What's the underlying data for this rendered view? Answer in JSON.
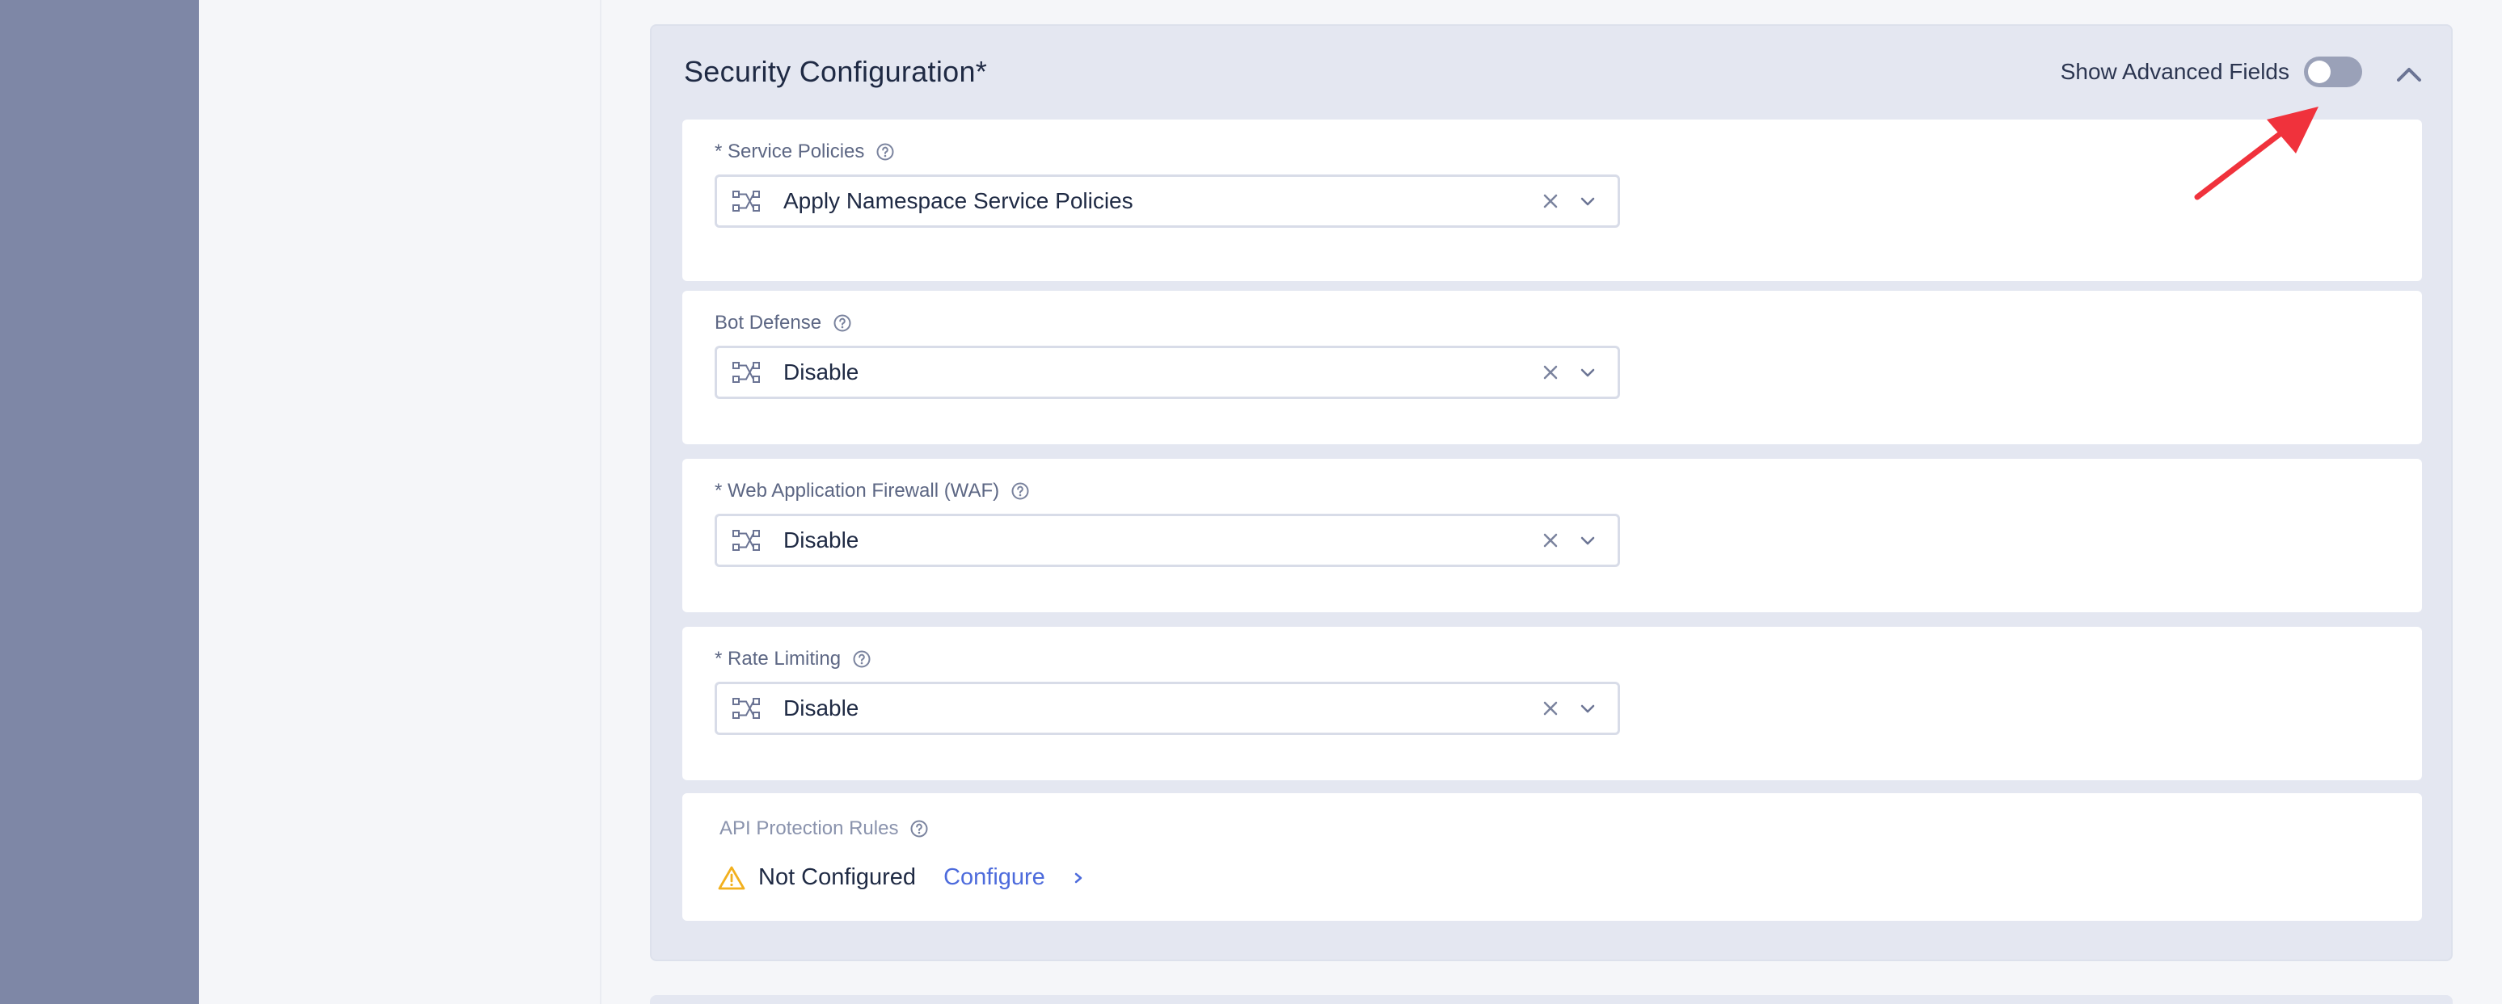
{
  "section": {
    "title": "Security Configuration*",
    "advanced_toggle_label": "Show Advanced Fields",
    "advanced_toggle_on": false
  },
  "fields": [
    {
      "label": "* Service Policies",
      "value": "Apply Namespace Service Policies"
    },
    {
      "label": "Bot Defense",
      "value": "Disable"
    },
    {
      "label": "* Web Application Firewall (WAF)",
      "value": "Disable"
    },
    {
      "label": "* Rate Limiting",
      "value": "Disable"
    }
  ],
  "api_protection": {
    "label": "API Protection Rules",
    "status": "Not Configured",
    "action": "Configure"
  },
  "colors": {
    "accent": "#4d6bdc",
    "warning": "#f2b01e",
    "annotation_arrow": "#f0323c"
  },
  "icons": {
    "help": "help-circle-icon",
    "select": "network-nodes-icon",
    "clear": "close-icon",
    "dropdown": "chevron-down-icon",
    "collapse": "chevron-up-icon",
    "warning": "warning-triangle-icon",
    "next": "chevron-right-icon"
  }
}
